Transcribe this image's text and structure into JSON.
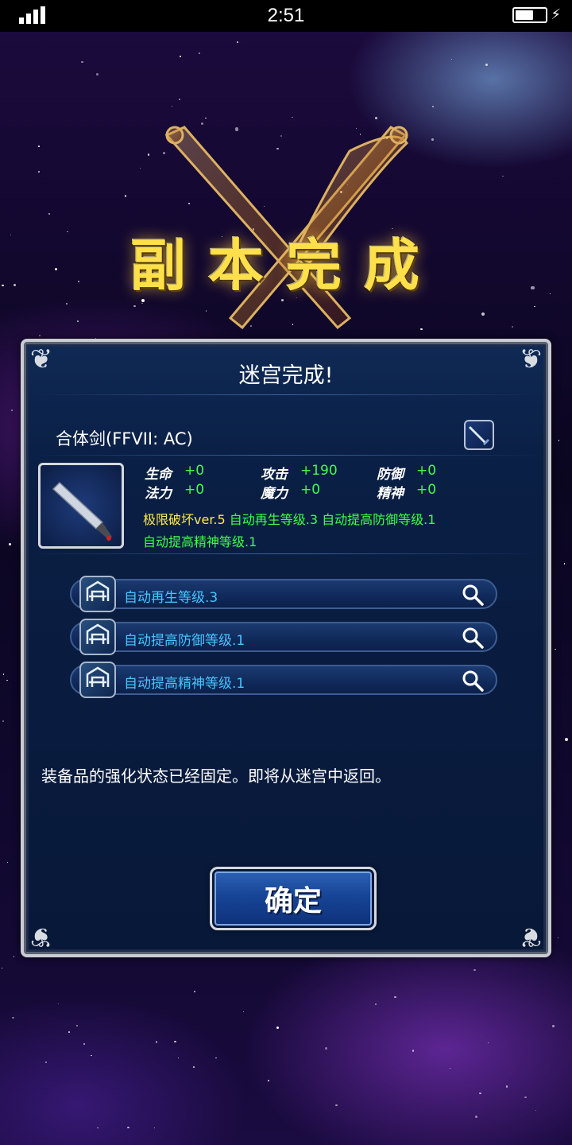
{
  "status_bar": {
    "time": "2:51",
    "battery_level_percent": 60
  },
  "banner": {
    "title": "副本完成"
  },
  "dialog": {
    "title": "迷宫完成!",
    "item": {
      "name": "合体剑(FFVII: AC)",
      "type_icon": "sword-icon",
      "image_icon": "buster-sword-icon"
    },
    "stats": [
      {
        "label": "生命",
        "value": "+0"
      },
      {
        "label": "攻击",
        "value": "+190"
      },
      {
        "label": "防御",
        "value": "+0"
      },
      {
        "label": "法力",
        "value": "+0"
      },
      {
        "label": "魔力",
        "value": "+0"
      },
      {
        "label": "精神",
        "value": "+0"
      }
    ],
    "abilities_text": {
      "highlight": "极限破坏ver.5",
      "line1_rest": "自动再生等级.3 自动提高防御等级.1",
      "line2": "自动提高精神等级.1"
    },
    "ability_rows": [
      {
        "label": "自动再生等级.3",
        "icon": "ability-icon"
      },
      {
        "label": "自动提高防御等级.1",
        "icon": "ability-icon"
      },
      {
        "label": "自动提高精神等级.1",
        "icon": "ability-icon"
      }
    ],
    "message": "装备品的强化状态已经固定。即将从迷宫中返回。",
    "confirm_label": "确定"
  },
  "colors": {
    "stat_value": "#3fff4a",
    "ability_highlight": "#ffe94a",
    "ability_row_text": "#44c6ff",
    "banner_text": "#ffe04a"
  }
}
